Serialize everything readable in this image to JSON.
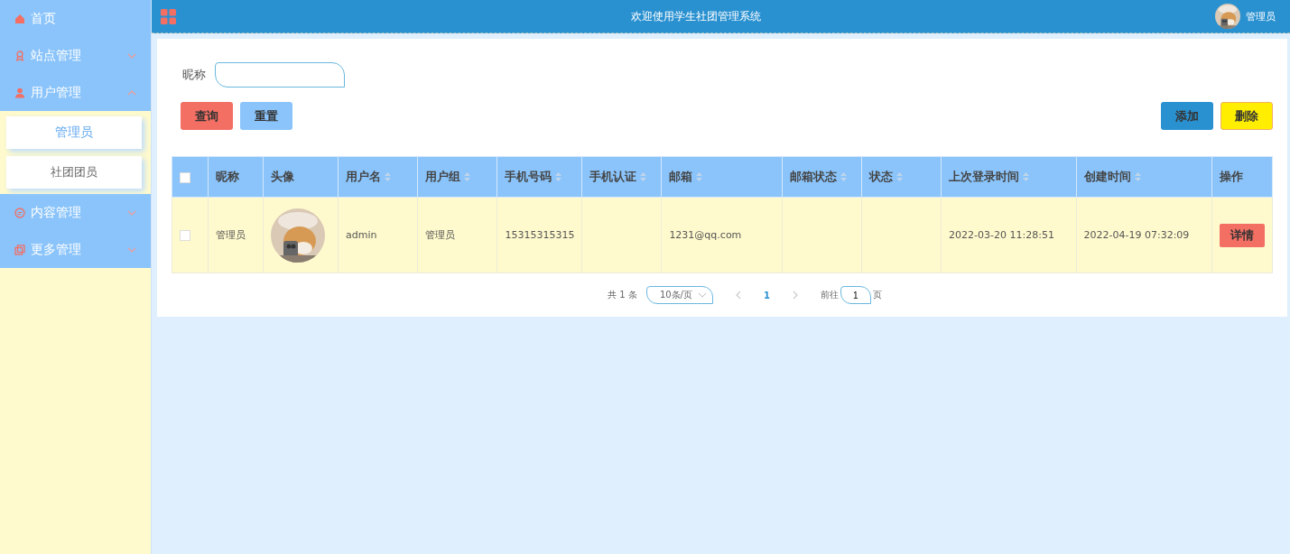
{
  "sidebar": {
    "items": [
      {
        "label": "首页",
        "kind": "link"
      },
      {
        "label": "站点管理",
        "kind": "group",
        "expanded": false
      },
      {
        "label": "用户管理",
        "kind": "group",
        "expanded": true,
        "children": [
          {
            "label": "管理员",
            "selected": true
          },
          {
            "label": "社团团员",
            "selected": false
          }
        ]
      },
      {
        "label": "内容管理",
        "kind": "group",
        "expanded": false
      },
      {
        "label": "更多管理",
        "kind": "group",
        "expanded": false
      }
    ]
  },
  "header": {
    "title": "欢迎使用学生社团管理系统",
    "user": "管理员"
  },
  "search": {
    "label": "昵称",
    "buttons": [
      {
        "label": "查询",
        "kind": "query"
      },
      {
        "label": "重置",
        "kind": "reset"
      }
    ]
  },
  "actions": [
    {
      "label": "添加",
      "kind": "add"
    },
    {
      "label": "删除",
      "kind": "delete"
    }
  ],
  "table": {
    "header_checked": false,
    "columns": [
      {
        "label": "昵称",
        "sortable": false
      },
      {
        "label": "头像",
        "sortable": false
      },
      {
        "label": "用户名",
        "sortable": true
      },
      {
        "label": "用户组",
        "sortable": true
      },
      {
        "label": "手机号码",
        "sortable": true
      },
      {
        "label": "手机认证",
        "sortable": true
      },
      {
        "label": "邮箱",
        "sortable": true
      },
      {
        "label": "邮箱状态",
        "sortable": true
      },
      {
        "label": "状态",
        "sortable": true
      },
      {
        "label": "上次登录时间",
        "sortable": true
      },
      {
        "label": "创建时间",
        "sortable": true
      },
      {
        "label": "操作",
        "sortable": false
      }
    ],
    "rows": [
      {
        "checked": false,
        "cells": [
          {
            "kind": "text",
            "text": "管理员"
          },
          {
            "kind": "picture"
          },
          {
            "kind": "text",
            "text": "admin"
          },
          {
            "kind": "text",
            "text": "管理员"
          },
          {
            "kind": "text",
            "text": "15315315315"
          },
          {
            "kind": "empty"
          },
          {
            "kind": "text",
            "text": "1231@qq.com"
          },
          {
            "kind": "empty"
          },
          {
            "kind": "empty"
          },
          {
            "kind": "text",
            "text": "2022-03-20 11:28:51"
          },
          {
            "kind": "text",
            "text": "2022-04-19 07:32:09"
          },
          {
            "kind": "button",
            "text": "详情"
          }
        ]
      }
    ]
  },
  "pagination": {
    "total": "共 1 条",
    "page_size": "10条/页",
    "pages": [
      {
        "label": "1",
        "selected": true
      }
    ],
    "goto_label": "前往",
    "goto_value": "1",
    "goto_suffix": "页"
  }
}
